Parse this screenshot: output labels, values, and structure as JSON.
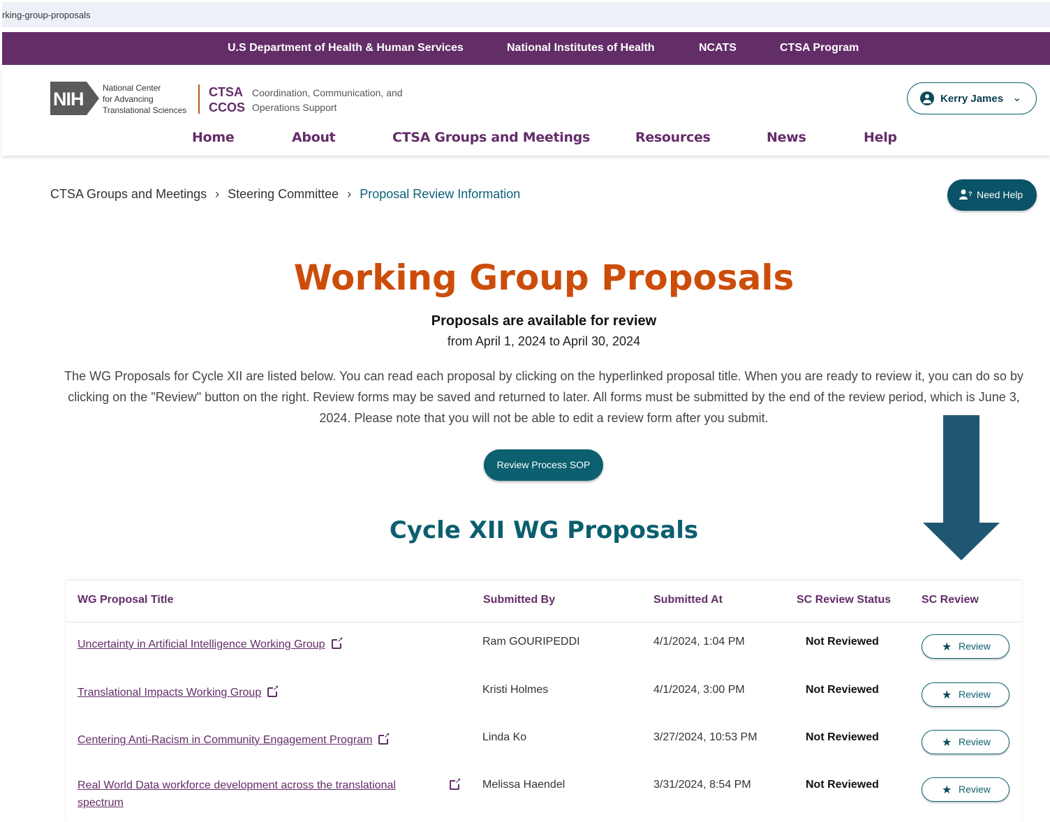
{
  "browser": {
    "url_fragment": "rking-group-proposals"
  },
  "top_links": [
    "U.S Department of Health & Human Services",
    "National Institutes of Health",
    "NCATS",
    "CTSA Program"
  ],
  "brand": {
    "nih": "NIH",
    "nih_lines": [
      "National Center",
      "for Advancing",
      "Translational Sciences"
    ],
    "ctsa": "CTSA",
    "ccos": "CCOS",
    "desc_lines": [
      "Coordination, Communication, and",
      "Operations Support"
    ]
  },
  "user": {
    "name": "Kerry James"
  },
  "nav": [
    "Home",
    "About",
    "CTSA Groups and Meetings",
    "Resources",
    "News",
    "Help"
  ],
  "breadcrumb": [
    "CTSA Groups and Meetings",
    "Steering Committee",
    "Proposal Review Information"
  ],
  "help_button": "Need Help",
  "page": {
    "title": "Working Group Proposals",
    "availability": "Proposals are available for review",
    "dates": "from April 1, 2024 to April 30, 2024",
    "intro": "The WG Proposals for Cycle XII are listed below. You can read each proposal by clicking on the hyperlinked proposal title. When you are ready to review it, you can do so by clicking on the \"Review\" button on the right. Review forms may be saved and returned to later. All forms must be submitted by the end of the review period, which is June 3, 2024.  Please note that you will not be able to edit a review form after you submit.",
    "sop_button": "Review Process SOP",
    "cycle_title": "Cycle XII WG Proposals"
  },
  "table": {
    "headers": [
      "WG Proposal Title",
      "Submitted By",
      "Submitted At",
      "SC Review Status",
      "SC Review"
    ],
    "rows": [
      {
        "title": "Uncertainty in Artificial Intelligence Working Group",
        "by": "Ram GOURIPEDDI",
        "at": "4/1/2024, 1:04 PM",
        "status": "Not Reviewed",
        "action": "Review"
      },
      {
        "title": "Translational Impacts Working Group",
        "by": "Kristi Holmes",
        "at": "4/1/2024, 3:00 PM",
        "status": "Not Reviewed",
        "action": "Review"
      },
      {
        "title": "Centering Anti-Racism in Community Engagement Program",
        "by": "Linda Ko",
        "at": "3/27/2024, 10:53 PM",
        "status": "Not Reviewed",
        "action": "Review"
      },
      {
        "title_lines": [
          "Real World Data workforce development across the translational",
          "spectrum"
        ],
        "by": "Melissa Haendel",
        "at": "3/31/2024, 8:54 PM",
        "status": "Not Reviewed",
        "action": "Review"
      }
    ]
  },
  "colors": {
    "purple": "#632d68",
    "orange": "#cc4d0a",
    "teal": "#0b5f6f",
    "arrow": "#1f5773"
  },
  "icons": [
    "user-circle-icon",
    "chevron-down-icon",
    "help-user-icon",
    "external-link-icon",
    "star-icon",
    "down-arrow-annotation"
  ]
}
